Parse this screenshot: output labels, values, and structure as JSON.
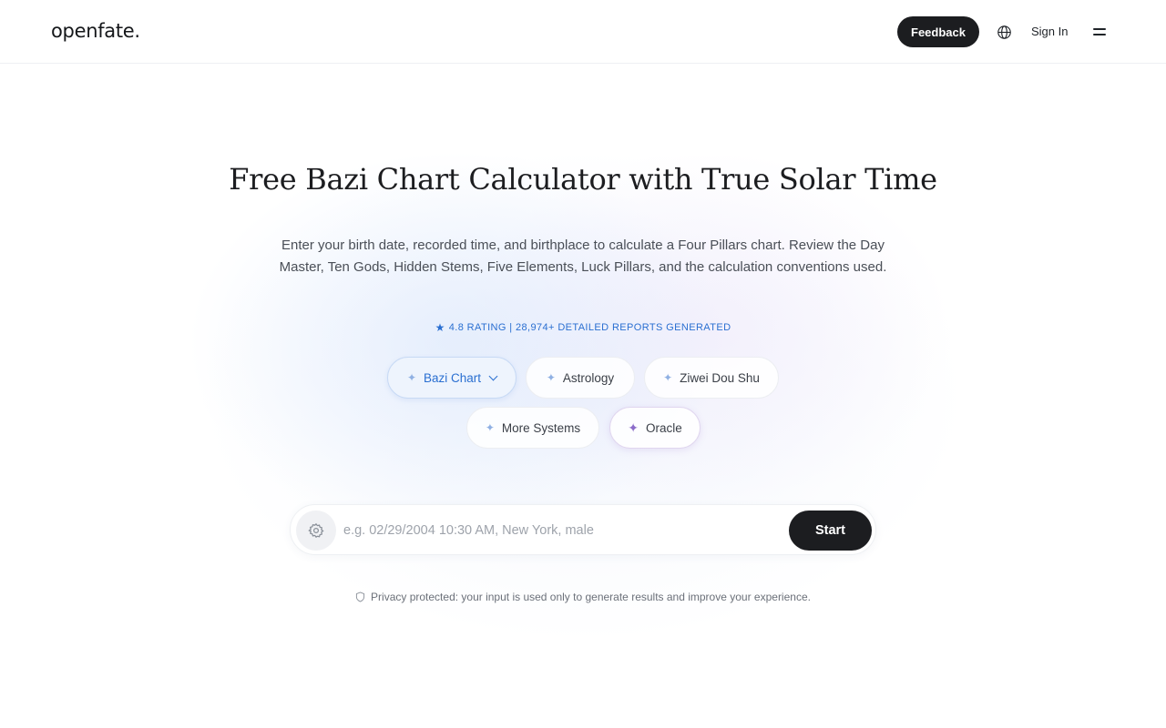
{
  "header": {
    "logo": "openfate.",
    "feedback_label": "Feedback",
    "signin_label": "Sign In",
    "icons": [
      "globe-icon",
      "menu-icon"
    ]
  },
  "hero": {
    "title": "Free Bazi Chart Calculator with True Solar Time",
    "subtitle": "Enter your birth date, recorded time, and birthplace to calculate a Four Pillars chart. Review the Day Master, Ten Gods, Hidden Stems, Five Elements, Luck Pillars, and the calculation conventions used.",
    "rating": "4.8 RATING | 28,974+ DETAILED REPORTS GENERATED"
  },
  "systems": [
    {
      "label": "Bazi Chart",
      "active": true
    },
    {
      "label": "Astrology",
      "active": false
    },
    {
      "label": "Ziwei Dou Shu",
      "active": false
    },
    {
      "label": "More Systems",
      "active": false
    },
    {
      "label": "Oracle",
      "active": false
    }
  ],
  "search": {
    "placeholder": "e.g. 02/29/2004 10:30 AM, New York, male",
    "value": "",
    "start_label": "Start"
  },
  "privacy": "Privacy protected: your input is used only to generate results and improve your experience.",
  "colors": {
    "accent": "#2a6fd1",
    "dark": "#1c1d20",
    "oracle": "#8b6cc9"
  }
}
